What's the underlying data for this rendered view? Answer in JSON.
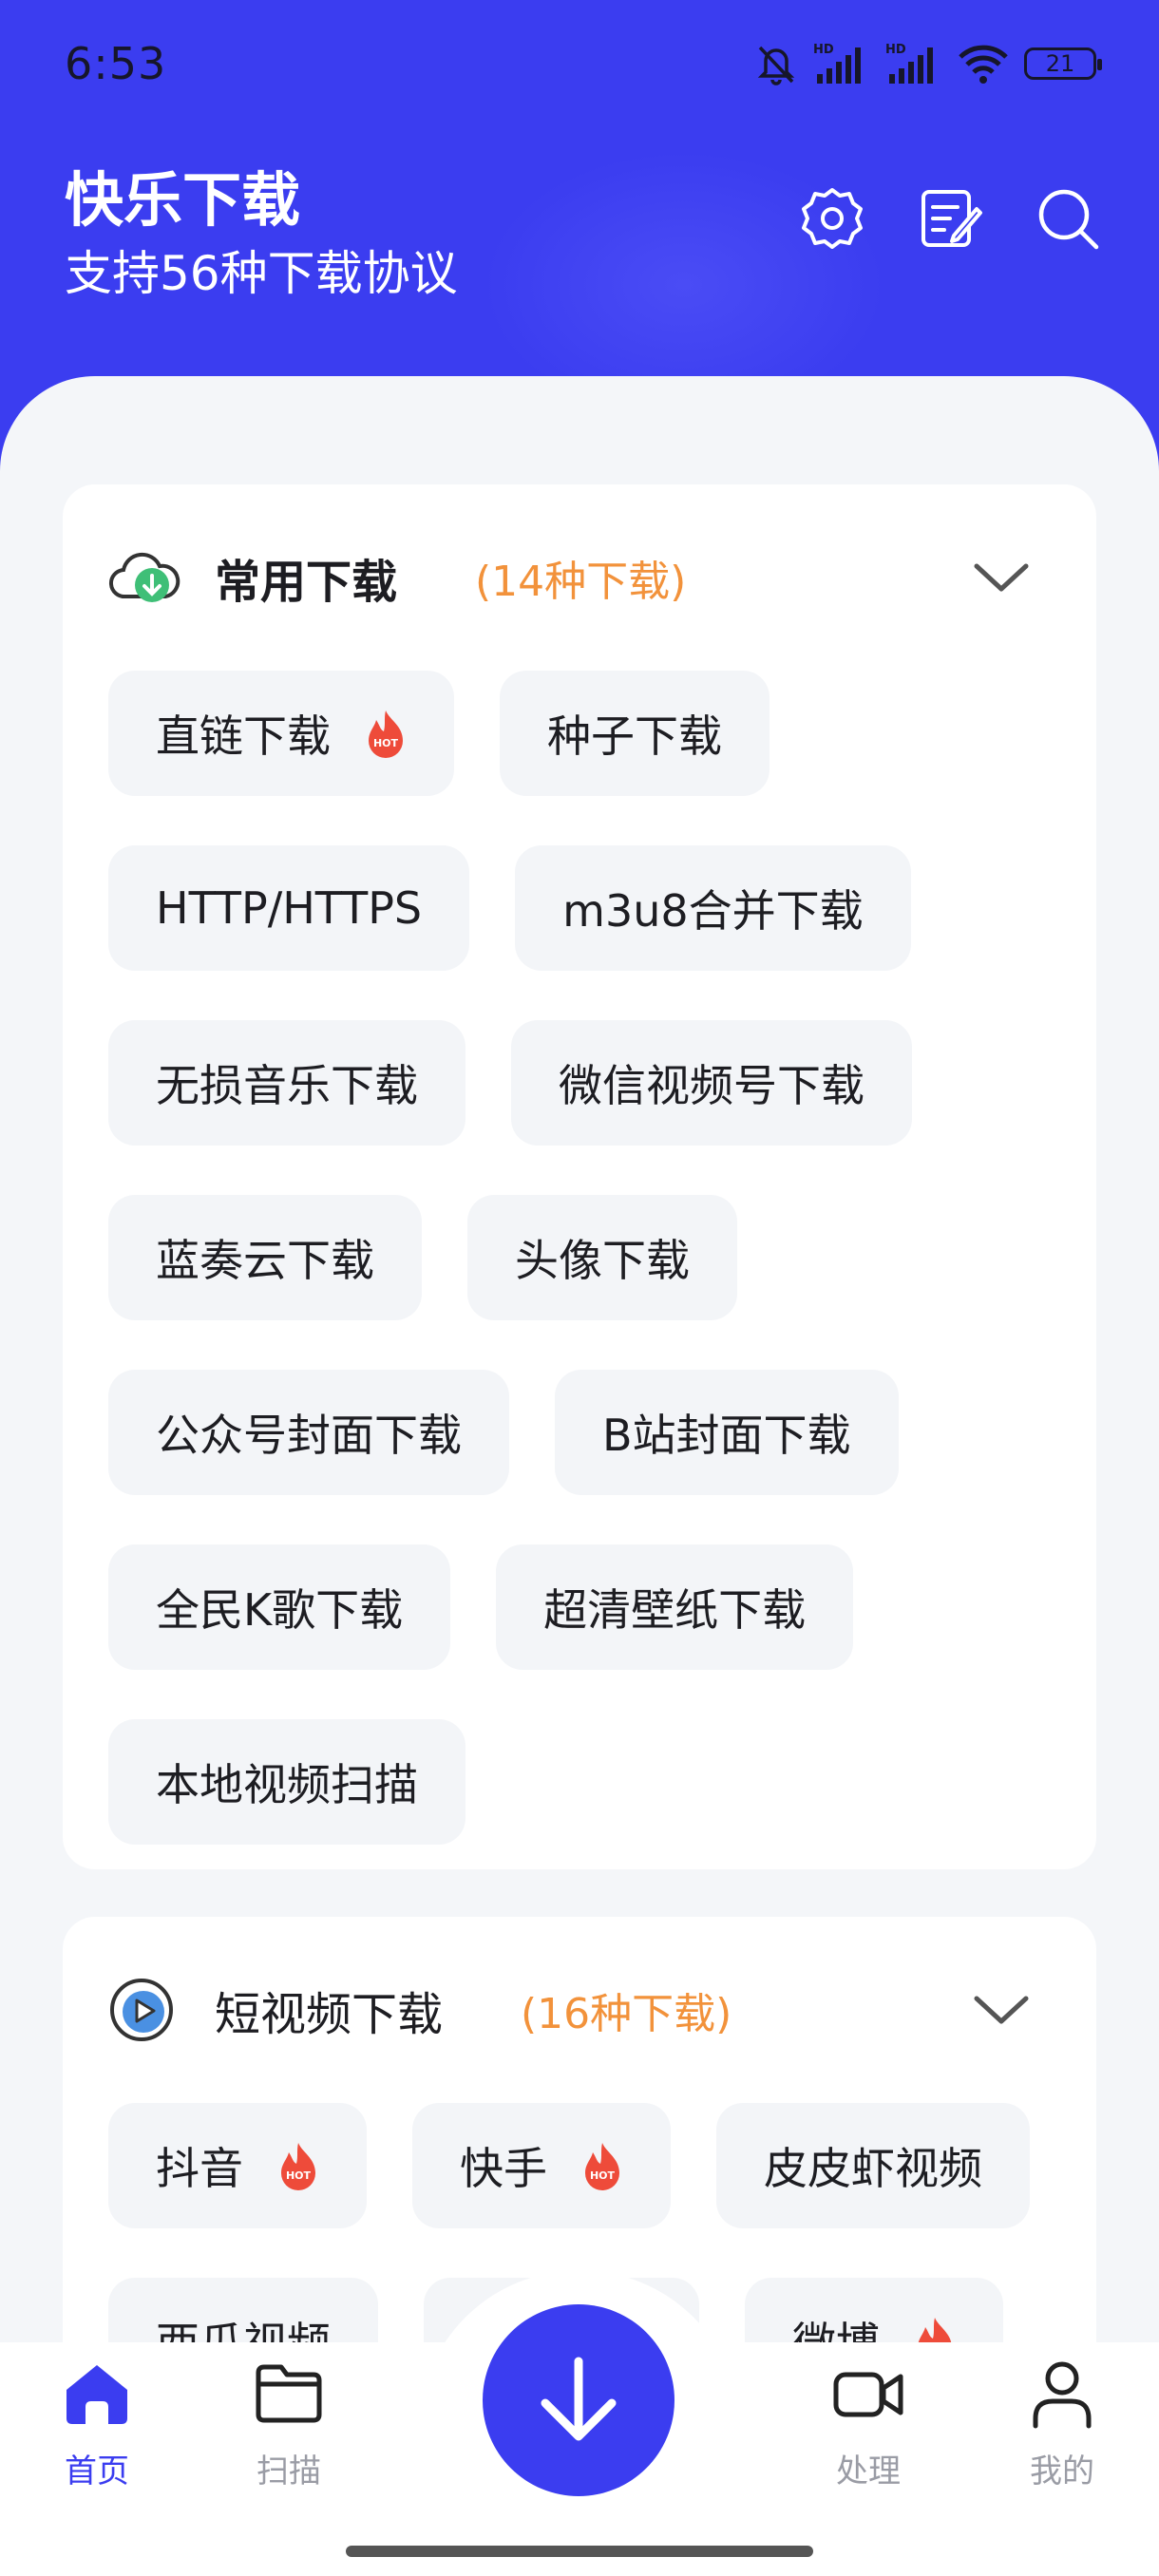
{
  "status_bar": {
    "time": "6:53",
    "battery": "21",
    "signal_label": "HD"
  },
  "header": {
    "title": "快乐下载",
    "subtitle": "支持56种下载协议"
  },
  "common_section": {
    "title": "常用下载",
    "count": "(14种下载)",
    "items": [
      {
        "label": "直链下载",
        "hot": true
      },
      {
        "label": "种子下载",
        "hot": false
      },
      {
        "label": "HTTP/HTTPS",
        "hot": false
      },
      {
        "label": "m3u8合并下载",
        "hot": false
      },
      {
        "label": "无损音乐下载",
        "hot": false
      },
      {
        "label": "微信视频号下载",
        "hot": false
      },
      {
        "label": "蓝奏云下载",
        "hot": false
      },
      {
        "label": "头像下载",
        "hot": false
      },
      {
        "label": "公众号封面下载",
        "hot": false
      },
      {
        "label": "B站封面下载",
        "hot": false
      },
      {
        "label": "全民K歌下载",
        "hot": false
      },
      {
        "label": "超清壁纸下载",
        "hot": false
      },
      {
        "label": "本地视频扫描",
        "hot": false
      }
    ]
  },
  "video_section": {
    "title": "短视频下载",
    "count": "(16种下载)",
    "items": [
      {
        "label": "抖音",
        "hot": true
      },
      {
        "label": "快手",
        "hot": true
      },
      {
        "label": "皮皮虾视频",
        "hot": false
      },
      {
        "label": "西瓜视频",
        "hot": false
      },
      {
        "label": "",
        "hot": false
      },
      {
        "label": "微博",
        "hot": true
      }
    ]
  },
  "hot_badge": "HOT",
  "nav": {
    "home": "首页",
    "scan": "扫描",
    "process": "处理",
    "mine": "我的"
  },
  "colors": {
    "primary": "#3b3df0",
    "accent": "#f2923b",
    "hot": "#ee4b3a"
  }
}
